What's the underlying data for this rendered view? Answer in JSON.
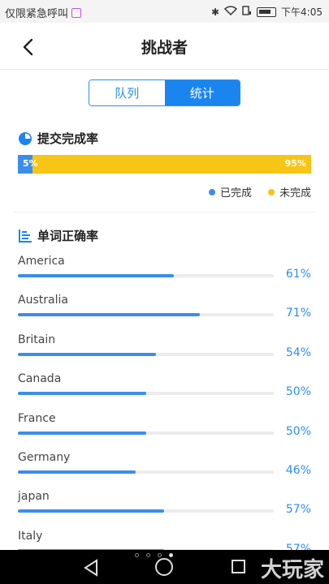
{
  "status_bar": {
    "left_text": "仅限紧急呼叫",
    "time": "下午4:05"
  },
  "header": {
    "title": "挑战者"
  },
  "tabs": [
    {
      "label": "队列",
      "active": false
    },
    {
      "label": "统计",
      "active": true
    }
  ],
  "completion": {
    "title": "提交完成率",
    "done_percent": 5,
    "done_label": "5%",
    "todo_label": "95%",
    "legend_done": "已完成",
    "legend_todo": "未完成",
    "color_done": "#3b8ee8",
    "color_todo": "#f6c515"
  },
  "accuracy": {
    "title": "单词正确率",
    "items": [
      {
        "name": "America",
        "percent": 61,
        "label": "61%"
      },
      {
        "name": "Australia",
        "percent": 71,
        "label": "71%"
      },
      {
        "name": "Britain",
        "percent": 54,
        "label": "54%"
      },
      {
        "name": "Canada",
        "percent": 50,
        "label": "50%"
      },
      {
        "name": "France",
        "percent": 50,
        "label": "50%"
      },
      {
        "name": "Germany",
        "percent": 46,
        "label": "46%"
      },
      {
        "name": "japan",
        "percent": 57,
        "label": "57%"
      },
      {
        "name": "Italy",
        "percent": 57,
        "label": "57%"
      }
    ]
  },
  "nav": {
    "watermark": "大玩家"
  }
}
